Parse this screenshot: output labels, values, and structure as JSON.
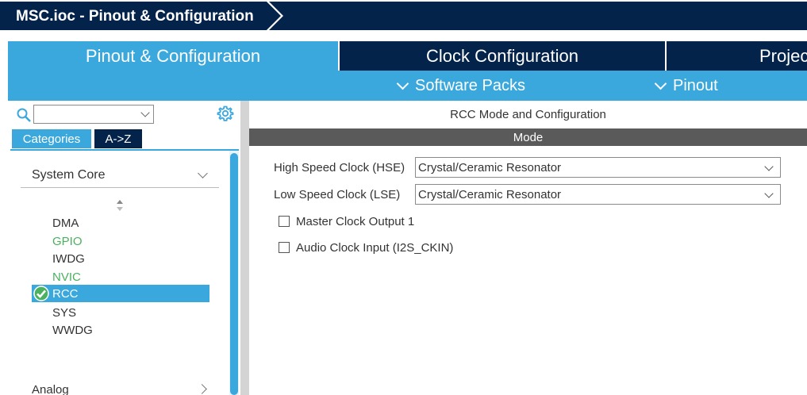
{
  "title": "MSC.ioc - Pinout & Configuration",
  "main_tabs": [
    {
      "label": "Pinout & Configuration",
      "active": true
    },
    {
      "label": "Clock Configuration",
      "active": false
    },
    {
      "label": "Projec",
      "active": false
    }
  ],
  "sub_menu": [
    {
      "label": "Software Packs"
    },
    {
      "label": "Pinout"
    }
  ],
  "sidebar": {
    "search": {
      "value": ""
    },
    "tabs": [
      {
        "label": "Categories",
        "active": true
      },
      {
        "label": "A->Z",
        "active": false
      }
    ],
    "category": "System Core",
    "peripherals": [
      {
        "label": "DMA",
        "state": "normal"
      },
      {
        "label": "GPIO",
        "state": "green"
      },
      {
        "label": "IWDG",
        "state": "normal"
      },
      {
        "label": "NVIC",
        "state": "green"
      },
      {
        "label": "RCC",
        "state": "selected"
      },
      {
        "label": "SYS",
        "state": "normal"
      },
      {
        "label": "WWDG",
        "state": "normal"
      }
    ],
    "next_category": "Analog"
  },
  "panel": {
    "title": "RCC Mode and Configuration",
    "mode_header": "Mode",
    "fields": [
      {
        "label": "High Speed Clock (HSE)",
        "value": "Crystal/Ceramic Resonator"
      },
      {
        "label": "Low Speed Clock (LSE)",
        "value": "Crystal/Ceramic Resonator"
      }
    ],
    "checkboxes": [
      {
        "label": "Master Clock Output 1",
        "checked": false
      },
      {
        "label": "Audio Clock Input (I2S_CKIN)",
        "checked": false
      }
    ]
  },
  "colors": {
    "dark_navy": "#03234b",
    "accent_blue": "#3aa8dc",
    "enabled_green": "#4bb15f",
    "mode_bar": "#5a5a5a"
  }
}
